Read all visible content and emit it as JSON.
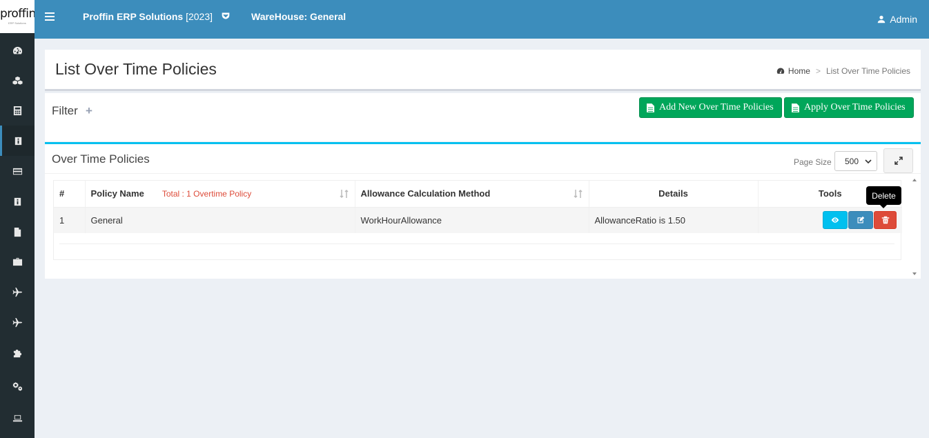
{
  "brand": {
    "logo_text": "proffin",
    "logo_sub": "ERP Solutions"
  },
  "header": {
    "app_name": "Proffin ERP Solutions",
    "app_year": "[2023]",
    "warehouse": "WareHouse: General",
    "user": "Admin"
  },
  "sidebar": {
    "items": [
      {
        "icon": "dashboard-icon"
      },
      {
        "icon": "cubes-icon"
      },
      {
        "icon": "calculator-icon"
      },
      {
        "icon": "info-icon",
        "active": true
      },
      {
        "icon": "credit-card-icon"
      },
      {
        "icon": "info-icon"
      },
      {
        "icon": "file-icon"
      },
      {
        "icon": "briefcase-icon"
      },
      {
        "icon": "plane-icon"
      },
      {
        "icon": "plane-icon"
      },
      {
        "icon": "puzzle-icon"
      },
      {
        "icon": "cogs-icon"
      },
      {
        "icon": "laptop-icon"
      }
    ]
  },
  "page": {
    "title": "List Over Time Policies",
    "breadcrumb": {
      "home": "Home",
      "separator": ">",
      "current": "List Over Time Policies"
    }
  },
  "filter": {
    "label": "Filter",
    "toggle": "+",
    "add_button": "Add New Over Time Policies",
    "apply_button": "Apply Over Time Policies"
  },
  "policies": {
    "title": "Over Time Policies",
    "page_size_label": "Page Size",
    "page_size_value": "500",
    "columns": {
      "index": "#",
      "name": "Policy Name",
      "total_note": "Total : 1 Overtime Policy",
      "method": "Allowance Calculation Method",
      "details": "Details",
      "tools": "Tools"
    },
    "rows": [
      {
        "index": "1",
        "name": "General",
        "method": "WorkHourAllowance",
        "details": "AllowanceRatio is 1.50"
      }
    ],
    "tooltip": "Delete"
  },
  "colors": {
    "header": "#3c8dbc",
    "sidebar": "#222d32",
    "success": "#00a65a",
    "info": "#00c0ef",
    "danger": "#dd4b39",
    "primary": "#3c8dbc"
  }
}
